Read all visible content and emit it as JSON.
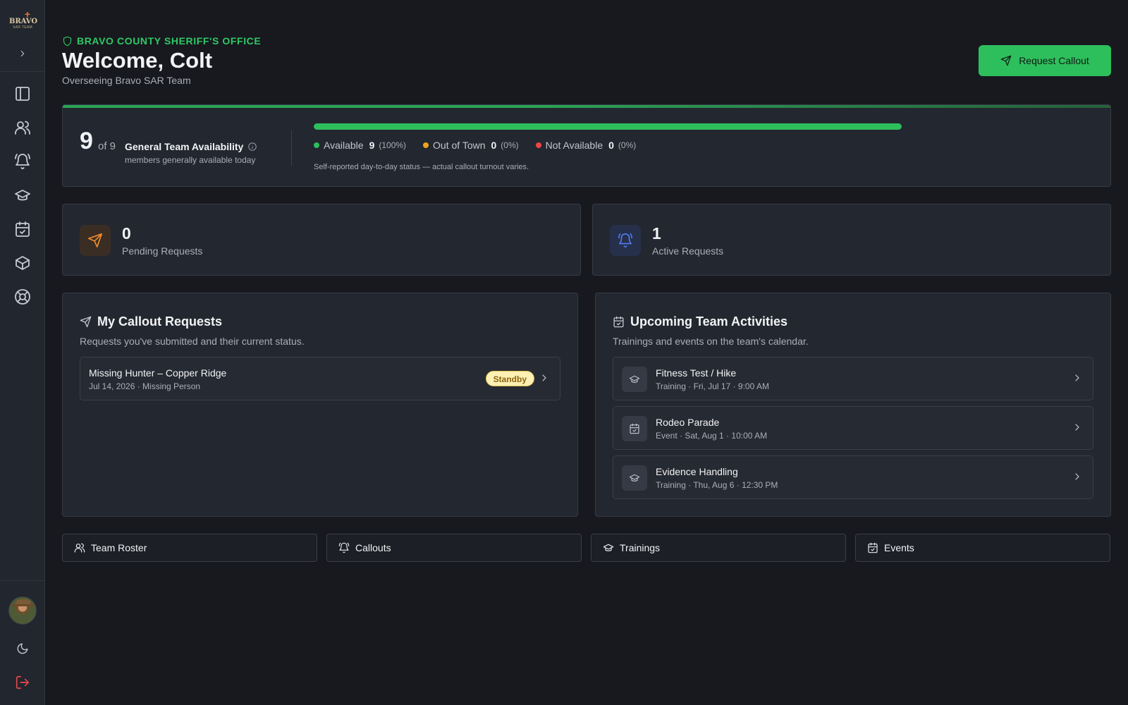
{
  "sidebar": {
    "logo_text": "BRAVO",
    "logo_sub": "SAR TEAM",
    "nav": [
      {
        "name": "dashboard"
      },
      {
        "name": "team"
      },
      {
        "name": "callouts"
      },
      {
        "name": "trainings"
      },
      {
        "name": "events"
      },
      {
        "name": "inventory"
      },
      {
        "name": "help"
      }
    ]
  },
  "header": {
    "org": "Bravo County Sheriff's Office",
    "welcome": "Welcome, Colt",
    "subtitle": "Overseeing Bravo SAR Team",
    "request_button": "Request Callout"
  },
  "availability": {
    "count": "9",
    "of_total": "of 9",
    "title": "General Team Availability",
    "subtitle": "members generally available today",
    "available_fraction": 1.0,
    "legend": [
      {
        "label": "Available",
        "count": "9",
        "pct": "(100%)",
        "color": "#2ebf5d"
      },
      {
        "label": "Out of Town",
        "count": "0",
        "pct": "(0%)",
        "color": "#f0a21c"
      },
      {
        "label": "Not Available",
        "count": "0",
        "pct": "(0%)",
        "color": "#ef4444"
      }
    ],
    "note": "Self-reported day-to-day status — actual callout turnout varies."
  },
  "stats": {
    "pending": {
      "value": "0",
      "label": "Pending Requests",
      "color": "#f08a2b"
    },
    "active": {
      "value": "1",
      "label": "Active Requests",
      "color": "#4f7df2"
    }
  },
  "callouts": {
    "title": "My Callout Requests",
    "subtitle": "Requests you've submitted and their current status.",
    "items": [
      {
        "title": "Missing Hunter – Copper Ridge",
        "meta": "Jul 14, 2026 · Missing Person",
        "status": "Standby"
      }
    ]
  },
  "activities": {
    "title": "Upcoming Team Activities",
    "subtitle": "Trainings and events on the team's calendar.",
    "items": [
      {
        "title": "Fitness Test / Hike",
        "meta": "Training · Fri, Jul 17 · 9:00 AM",
        "icon": "graduation-cap-icon"
      },
      {
        "title": "Rodeo Parade",
        "meta": "Event · Sat, Aug 1 · 10:00 AM",
        "icon": "calendar-check-icon"
      },
      {
        "title": "Evidence Handling",
        "meta": "Training · Thu, Aug 6 · 12:30 PM",
        "icon": "graduation-cap-icon"
      }
    ]
  },
  "quick_links": {
    "roster": "Team Roster",
    "callouts": "Callouts",
    "trainings": "Trainings",
    "events": "Events"
  }
}
